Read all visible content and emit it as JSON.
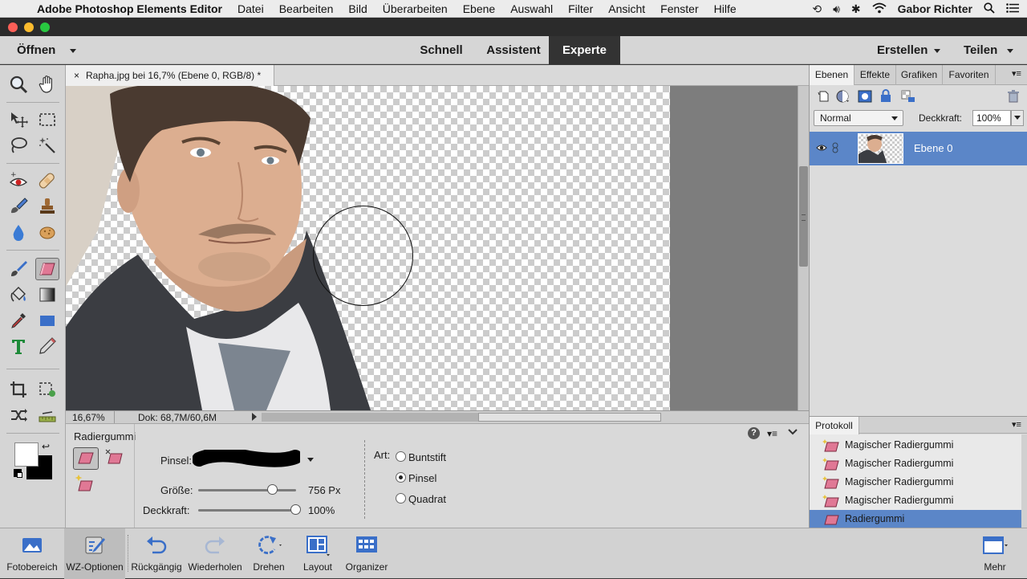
{
  "menubar": {
    "app_name": "Adobe Photoshop Elements Editor",
    "items": [
      "Datei",
      "Bearbeiten",
      "Bild",
      "Überarbeiten",
      "Ebene",
      "Auswahl",
      "Filter",
      "Ansicht",
      "Fenster",
      "Hilfe"
    ],
    "user": "Gabor Richter"
  },
  "header": {
    "open_label": "Öffnen",
    "modes": [
      "Schnell",
      "Assistent",
      "Experte"
    ],
    "active_mode": "Experte",
    "create_label": "Erstellen",
    "share_label": "Teilen"
  },
  "document": {
    "tab_title": "Rapha.jpg bei 16,7% (Ebene 0, RGB/8) *",
    "close_glyph": "×",
    "zoom": "16,67%",
    "doc_size": "Dok: 68,7M/60,6M"
  },
  "tool_options": {
    "tool_name": "Radiergummi",
    "brush_label": "Pinsel:",
    "size_label": "Größe:",
    "size_value": "756 Px",
    "size_fraction": 0.76,
    "opacity_label": "Deckkraft:",
    "opacity_value": "100%",
    "opacity_fraction": 1.0,
    "type_label": "Art:",
    "type_options": [
      "Buntstift",
      "Pinsel",
      "Quadrat"
    ],
    "selected_type": "Pinsel"
  },
  "layers_panel": {
    "tabs": [
      "Ebenen",
      "Effekte",
      "Grafiken",
      "Favoriten"
    ],
    "active_tab": "Ebenen",
    "blend_mode": "Normal",
    "opacity_label": "Deckkraft:",
    "opacity_value": "100%",
    "layers": [
      {
        "name": "Ebene 0",
        "visible": true
      }
    ]
  },
  "history_panel": {
    "title": "Protokoll",
    "items": [
      "Magischer Radiergummi",
      "Magischer Radiergummi",
      "Magischer Radiergummi",
      "Magischer Radiergummi",
      "Radiergummi"
    ],
    "selected_index": 4
  },
  "bottombar": {
    "items": [
      "Fotobereich",
      "WZ-Optionen",
      "Rückgängig",
      "Wiederholen",
      "Drehen",
      "Layout",
      "Organizer"
    ],
    "more_label": "Mehr"
  },
  "colors": {
    "selection_blue": "#5b86c8",
    "dark_mode_tab": "#333333",
    "eraser_pink": "#d86a86"
  }
}
